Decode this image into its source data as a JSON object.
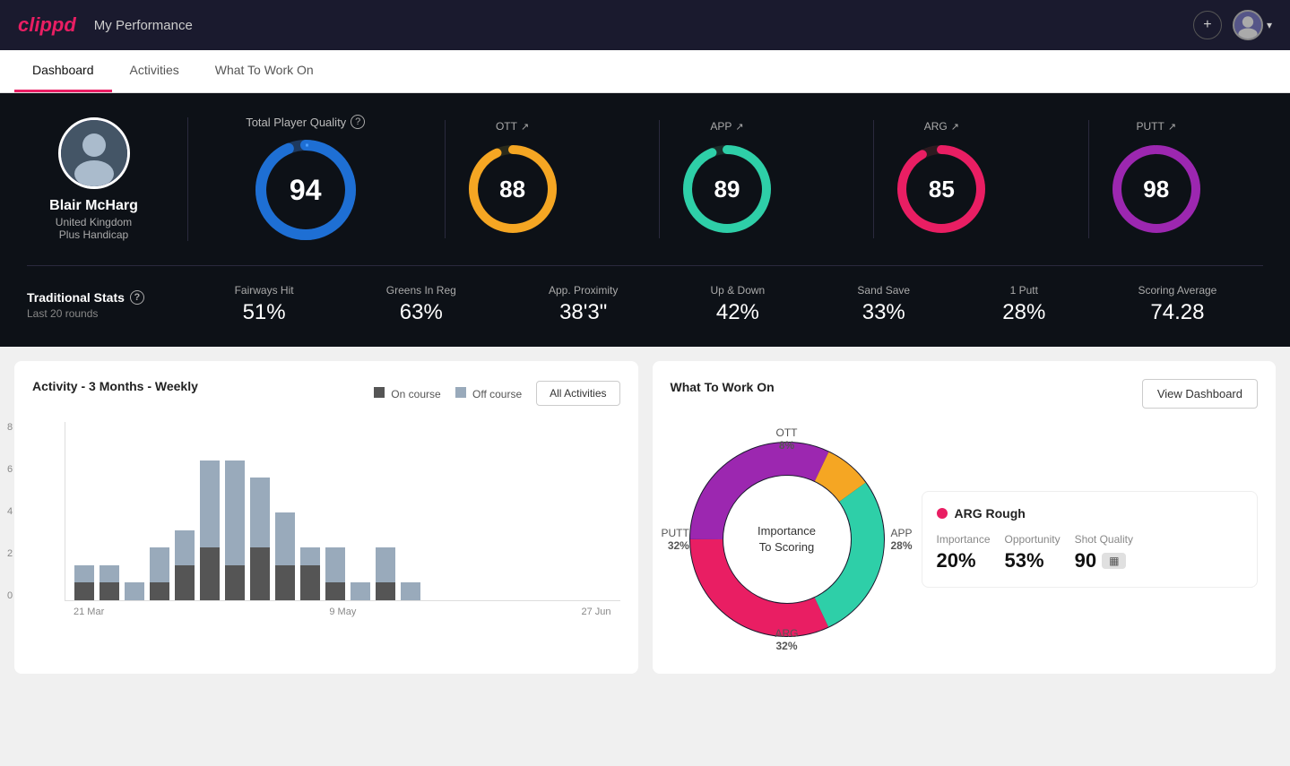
{
  "header": {
    "logo": "clippd",
    "title": "My Performance",
    "add_btn_label": "+",
    "avatar_chevron": "▾"
  },
  "tabs": [
    {
      "label": "Dashboard",
      "active": true
    },
    {
      "label": "Activities",
      "active": false
    },
    {
      "label": "What To Work On",
      "active": false
    }
  ],
  "player": {
    "name": "Blair McHarg",
    "country": "United Kingdom",
    "handicap": "Plus Handicap"
  },
  "tpq": {
    "label": "Total Player Quality",
    "value": 94,
    "categories": [
      {
        "key": "OTT",
        "value": 88,
        "color": "#f5a623",
        "track": "#3a3a2a"
      },
      {
        "key": "APP",
        "value": 89,
        "color": "#2ecfa8",
        "track": "#1a2e2a"
      },
      {
        "key": "ARG",
        "value": 85,
        "color": "#e91e63",
        "track": "#2e1a20"
      },
      {
        "key": "PUTT",
        "value": 98,
        "color": "#9c27b0",
        "track": "#1e1a2e"
      }
    ]
  },
  "traditional_stats": {
    "label": "Traditional Stats",
    "sublabel": "Last 20 rounds",
    "items": [
      {
        "name": "Fairways Hit",
        "value": "51%"
      },
      {
        "name": "Greens In Reg",
        "value": "63%"
      },
      {
        "name": "App. Proximity",
        "value": "38'3\""
      },
      {
        "name": "Up & Down",
        "value": "42%"
      },
      {
        "name": "Sand Save",
        "value": "33%"
      },
      {
        "name": "1 Putt",
        "value": "28%"
      },
      {
        "name": "Scoring Average",
        "value": "74.28"
      }
    ]
  },
  "activity_chart": {
    "title": "Activity - 3 Months - Weekly",
    "legend": {
      "on_course": "On course",
      "off_course": "Off course"
    },
    "btn_label": "All Activities",
    "y_labels": [
      "8",
      "6",
      "4",
      "2",
      "0"
    ],
    "x_labels": [
      "21 Mar",
      "9 May",
      "27 Jun"
    ],
    "bars": [
      {
        "on": 1,
        "off": 1
      },
      {
        "on": 1,
        "off": 1
      },
      {
        "on": 0,
        "off": 1
      },
      {
        "on": 1,
        "off": 2
      },
      {
        "on": 2,
        "off": 2
      },
      {
        "on": 3,
        "off": 5
      },
      {
        "on": 2,
        "off": 6
      },
      {
        "on": 3,
        "off": 4
      },
      {
        "on": 2,
        "off": 3
      },
      {
        "on": 2,
        "off": 1
      },
      {
        "on": 1,
        "off": 2
      },
      {
        "on": 0,
        "off": 1
      },
      {
        "on": 1,
        "off": 2
      },
      {
        "on": 0,
        "off": 1
      }
    ]
  },
  "wtwo": {
    "title": "What To Work On",
    "view_btn": "View Dashboard",
    "center_line1": "Importance",
    "center_line2": "To Scoring",
    "segments": [
      {
        "label": "OTT",
        "value": "8%",
        "color": "#f5a623"
      },
      {
        "label": "APP",
        "value": "28%",
        "color": "#2ecfa8"
      },
      {
        "label": "ARG",
        "value": "32%",
        "color": "#e91e63"
      },
      {
        "label": "PUTT",
        "value": "32%",
        "color": "#9c27b0"
      }
    ],
    "card": {
      "title": "ARG Rough",
      "dot_color": "#e91e63",
      "metrics": [
        {
          "label": "Importance",
          "value": "20%"
        },
        {
          "label": "Opportunity",
          "value": "53%"
        },
        {
          "label": "Shot Quality",
          "value": "90",
          "badge": ""
        }
      ]
    }
  }
}
